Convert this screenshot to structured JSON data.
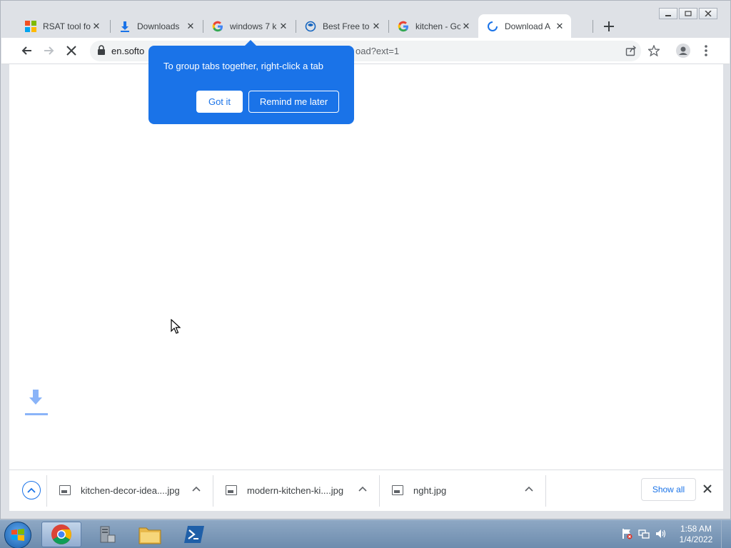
{
  "browser": {
    "tabs": [
      {
        "title": "RSAT tool fo",
        "icon": "microsoft-icon"
      },
      {
        "title": "Downloads",
        "icon": "download-icon"
      },
      {
        "title": "windows 7 k",
        "icon": "google-icon"
      },
      {
        "title": "Best Free to",
        "icon": "softonic-icon"
      },
      {
        "title": "kitchen - Go",
        "icon": "google-icon"
      },
      {
        "title": "Download A",
        "icon": "loading-spinner-icon",
        "active": true
      }
    ],
    "address": {
      "host": "en.softo",
      "path_tail": "oad?ext=1"
    }
  },
  "bubble": {
    "text": "To group tabs together, right-click a tab",
    "got_it": "Got it",
    "remind": "Remind me later"
  },
  "downloads": {
    "items": [
      {
        "name": "kitchen-decor-idea....jpg"
      },
      {
        "name": "modern-kitchen-ki....jpg"
      },
      {
        "name": "nght.jpg"
      }
    ],
    "show_all": "Show all"
  },
  "taskbar": {
    "time": "1:58 AM",
    "date": "1/4/2022"
  },
  "colors": {
    "accent": "#1a73e8",
    "chrome_frame": "#dee1e6"
  }
}
